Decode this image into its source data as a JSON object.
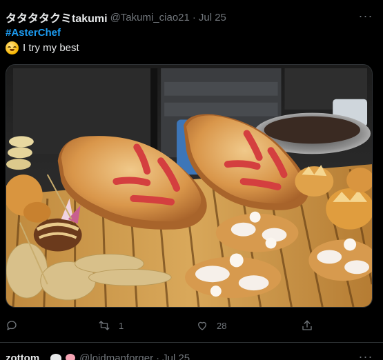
{
  "tweet": {
    "display_name": "タタタタクミtakumi",
    "handle": "@Takumi_ciao21",
    "separator": "·",
    "time": "Jul 25",
    "more_label": "···",
    "hashtag": "#AsterChef",
    "text": "I try my best",
    "emoji_icon": "sweat-smile-emoji-icon",
    "media_description_icon": "pastry-photo",
    "actions": {
      "reply_count": "",
      "retweet_count": "1",
      "like_count": "28",
      "share_count": ""
    },
    "colors": {
      "link": "#1d9bf0",
      "muted": "#71767b",
      "text": "#e7e9ea",
      "background": "#000000"
    }
  },
  "next_tweet": {
    "display_name": "zottom",
    "handle": "@loidmanforger",
    "separator": "·",
    "time": "Jul 25",
    "more_label": "···"
  }
}
